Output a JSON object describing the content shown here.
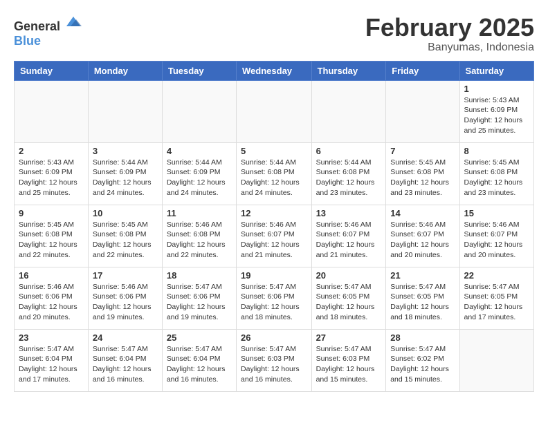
{
  "header": {
    "logo_general": "General",
    "logo_blue": "Blue",
    "month_title": "February 2025",
    "location": "Banyumas, Indonesia"
  },
  "weekdays": [
    "Sunday",
    "Monday",
    "Tuesday",
    "Wednesday",
    "Thursday",
    "Friday",
    "Saturday"
  ],
  "weeks": [
    [
      {
        "day": "",
        "info": ""
      },
      {
        "day": "",
        "info": ""
      },
      {
        "day": "",
        "info": ""
      },
      {
        "day": "",
        "info": ""
      },
      {
        "day": "",
        "info": ""
      },
      {
        "day": "",
        "info": ""
      },
      {
        "day": "1",
        "info": "Sunrise: 5:43 AM\nSunset: 6:09 PM\nDaylight: 12 hours\nand 25 minutes."
      }
    ],
    [
      {
        "day": "2",
        "info": "Sunrise: 5:43 AM\nSunset: 6:09 PM\nDaylight: 12 hours\nand 25 minutes."
      },
      {
        "day": "3",
        "info": "Sunrise: 5:44 AM\nSunset: 6:09 PM\nDaylight: 12 hours\nand 24 minutes."
      },
      {
        "day": "4",
        "info": "Sunrise: 5:44 AM\nSunset: 6:09 PM\nDaylight: 12 hours\nand 24 minutes."
      },
      {
        "day": "5",
        "info": "Sunrise: 5:44 AM\nSunset: 6:08 PM\nDaylight: 12 hours\nand 24 minutes."
      },
      {
        "day": "6",
        "info": "Sunrise: 5:44 AM\nSunset: 6:08 PM\nDaylight: 12 hours\nand 23 minutes."
      },
      {
        "day": "7",
        "info": "Sunrise: 5:45 AM\nSunset: 6:08 PM\nDaylight: 12 hours\nand 23 minutes."
      },
      {
        "day": "8",
        "info": "Sunrise: 5:45 AM\nSunset: 6:08 PM\nDaylight: 12 hours\nand 23 minutes."
      }
    ],
    [
      {
        "day": "9",
        "info": "Sunrise: 5:45 AM\nSunset: 6:08 PM\nDaylight: 12 hours\nand 22 minutes."
      },
      {
        "day": "10",
        "info": "Sunrise: 5:45 AM\nSunset: 6:08 PM\nDaylight: 12 hours\nand 22 minutes."
      },
      {
        "day": "11",
        "info": "Sunrise: 5:46 AM\nSunset: 6:08 PM\nDaylight: 12 hours\nand 22 minutes."
      },
      {
        "day": "12",
        "info": "Sunrise: 5:46 AM\nSunset: 6:07 PM\nDaylight: 12 hours\nand 21 minutes."
      },
      {
        "day": "13",
        "info": "Sunrise: 5:46 AM\nSunset: 6:07 PM\nDaylight: 12 hours\nand 21 minutes."
      },
      {
        "day": "14",
        "info": "Sunrise: 5:46 AM\nSunset: 6:07 PM\nDaylight: 12 hours\nand 20 minutes."
      },
      {
        "day": "15",
        "info": "Sunrise: 5:46 AM\nSunset: 6:07 PM\nDaylight: 12 hours\nand 20 minutes."
      }
    ],
    [
      {
        "day": "16",
        "info": "Sunrise: 5:46 AM\nSunset: 6:06 PM\nDaylight: 12 hours\nand 20 minutes."
      },
      {
        "day": "17",
        "info": "Sunrise: 5:46 AM\nSunset: 6:06 PM\nDaylight: 12 hours\nand 19 minutes."
      },
      {
        "day": "18",
        "info": "Sunrise: 5:47 AM\nSunset: 6:06 PM\nDaylight: 12 hours\nand 19 minutes."
      },
      {
        "day": "19",
        "info": "Sunrise: 5:47 AM\nSunset: 6:06 PM\nDaylight: 12 hours\nand 18 minutes."
      },
      {
        "day": "20",
        "info": "Sunrise: 5:47 AM\nSunset: 6:05 PM\nDaylight: 12 hours\nand 18 minutes."
      },
      {
        "day": "21",
        "info": "Sunrise: 5:47 AM\nSunset: 6:05 PM\nDaylight: 12 hours\nand 18 minutes."
      },
      {
        "day": "22",
        "info": "Sunrise: 5:47 AM\nSunset: 6:05 PM\nDaylight: 12 hours\nand 17 minutes."
      }
    ],
    [
      {
        "day": "23",
        "info": "Sunrise: 5:47 AM\nSunset: 6:04 PM\nDaylight: 12 hours\nand 17 minutes."
      },
      {
        "day": "24",
        "info": "Sunrise: 5:47 AM\nSunset: 6:04 PM\nDaylight: 12 hours\nand 16 minutes."
      },
      {
        "day": "25",
        "info": "Sunrise: 5:47 AM\nSunset: 6:04 PM\nDaylight: 12 hours\nand 16 minutes."
      },
      {
        "day": "26",
        "info": "Sunrise: 5:47 AM\nSunset: 6:03 PM\nDaylight: 12 hours\nand 16 minutes."
      },
      {
        "day": "27",
        "info": "Sunrise: 5:47 AM\nSunset: 6:03 PM\nDaylight: 12 hours\nand 15 minutes."
      },
      {
        "day": "28",
        "info": "Sunrise: 5:47 AM\nSunset: 6:02 PM\nDaylight: 12 hours\nand 15 minutes."
      },
      {
        "day": "",
        "info": ""
      }
    ]
  ]
}
